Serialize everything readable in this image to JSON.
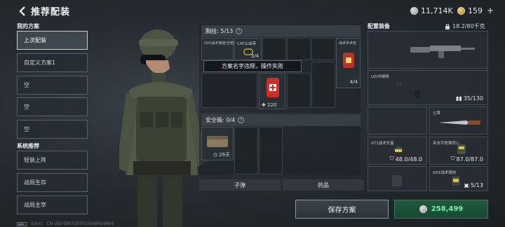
{
  "header": {
    "title": "推荐配装",
    "currency_silver": "11,714K",
    "currency_gold": "159"
  },
  "sidebar": {
    "my_plans_label": "我的方案",
    "my_plans": [
      {
        "label": "上次配装",
        "active": true
      },
      {
        "label": "自定义方案1",
        "active": false
      },
      {
        "label": "空",
        "active": false
      },
      {
        "label": "空",
        "active": false
      },
      {
        "label": "空",
        "active": false
      }
    ],
    "system_label": "系统推荐",
    "system_plans": [
      {
        "label": "轻装上阵"
      },
      {
        "label": "战局生存"
      },
      {
        "label": "战局主宰"
      }
    ],
    "status": {
      "ping": "52ms",
      "uid": "CN UID:9887197033568439894"
    }
  },
  "inventory": {
    "chest": {
      "header": "胸挂: 5/13",
      "items": [
        {
          "label": "G01战术弹挂(全密封)"
        },
        {
          "label": "CAT止血带",
          "qty": "3/4"
        },
        {
          "label": "战术手术包",
          "qty": "4/4"
        },
        {
          "label": "",
          "qty": "220"
        }
      ]
    },
    "tooltip": "方案名字违规，操作失败",
    "safe_box": {
      "header": "安全箱: 0/4",
      "item_qty": "29天"
    },
    "tabs": [
      "子弹",
      "药品"
    ]
  },
  "equipment": {
    "title": "配置装备",
    "weight": "18.2/80千克",
    "slots": [
      {
        "label": "",
        "value": ""
      },
      {
        "label": "UZI冲锋枪",
        "value": "35/130"
      },
      {
        "label": "",
        "value": ""
      },
      {
        "label": "匕首",
        "value": ""
      },
      {
        "label": "GT1战术头盔",
        "value": "48.0/48.0"
      },
      {
        "label": "突击手防弹背心",
        "value": "87.0/87.0"
      },
      {
        "label": "",
        "value": ""
      },
      {
        "label": "G01战术弹挂",
        "value": "5/13"
      }
    ]
  },
  "footer": {
    "save_label": "保存方案",
    "price": "258,499"
  }
}
